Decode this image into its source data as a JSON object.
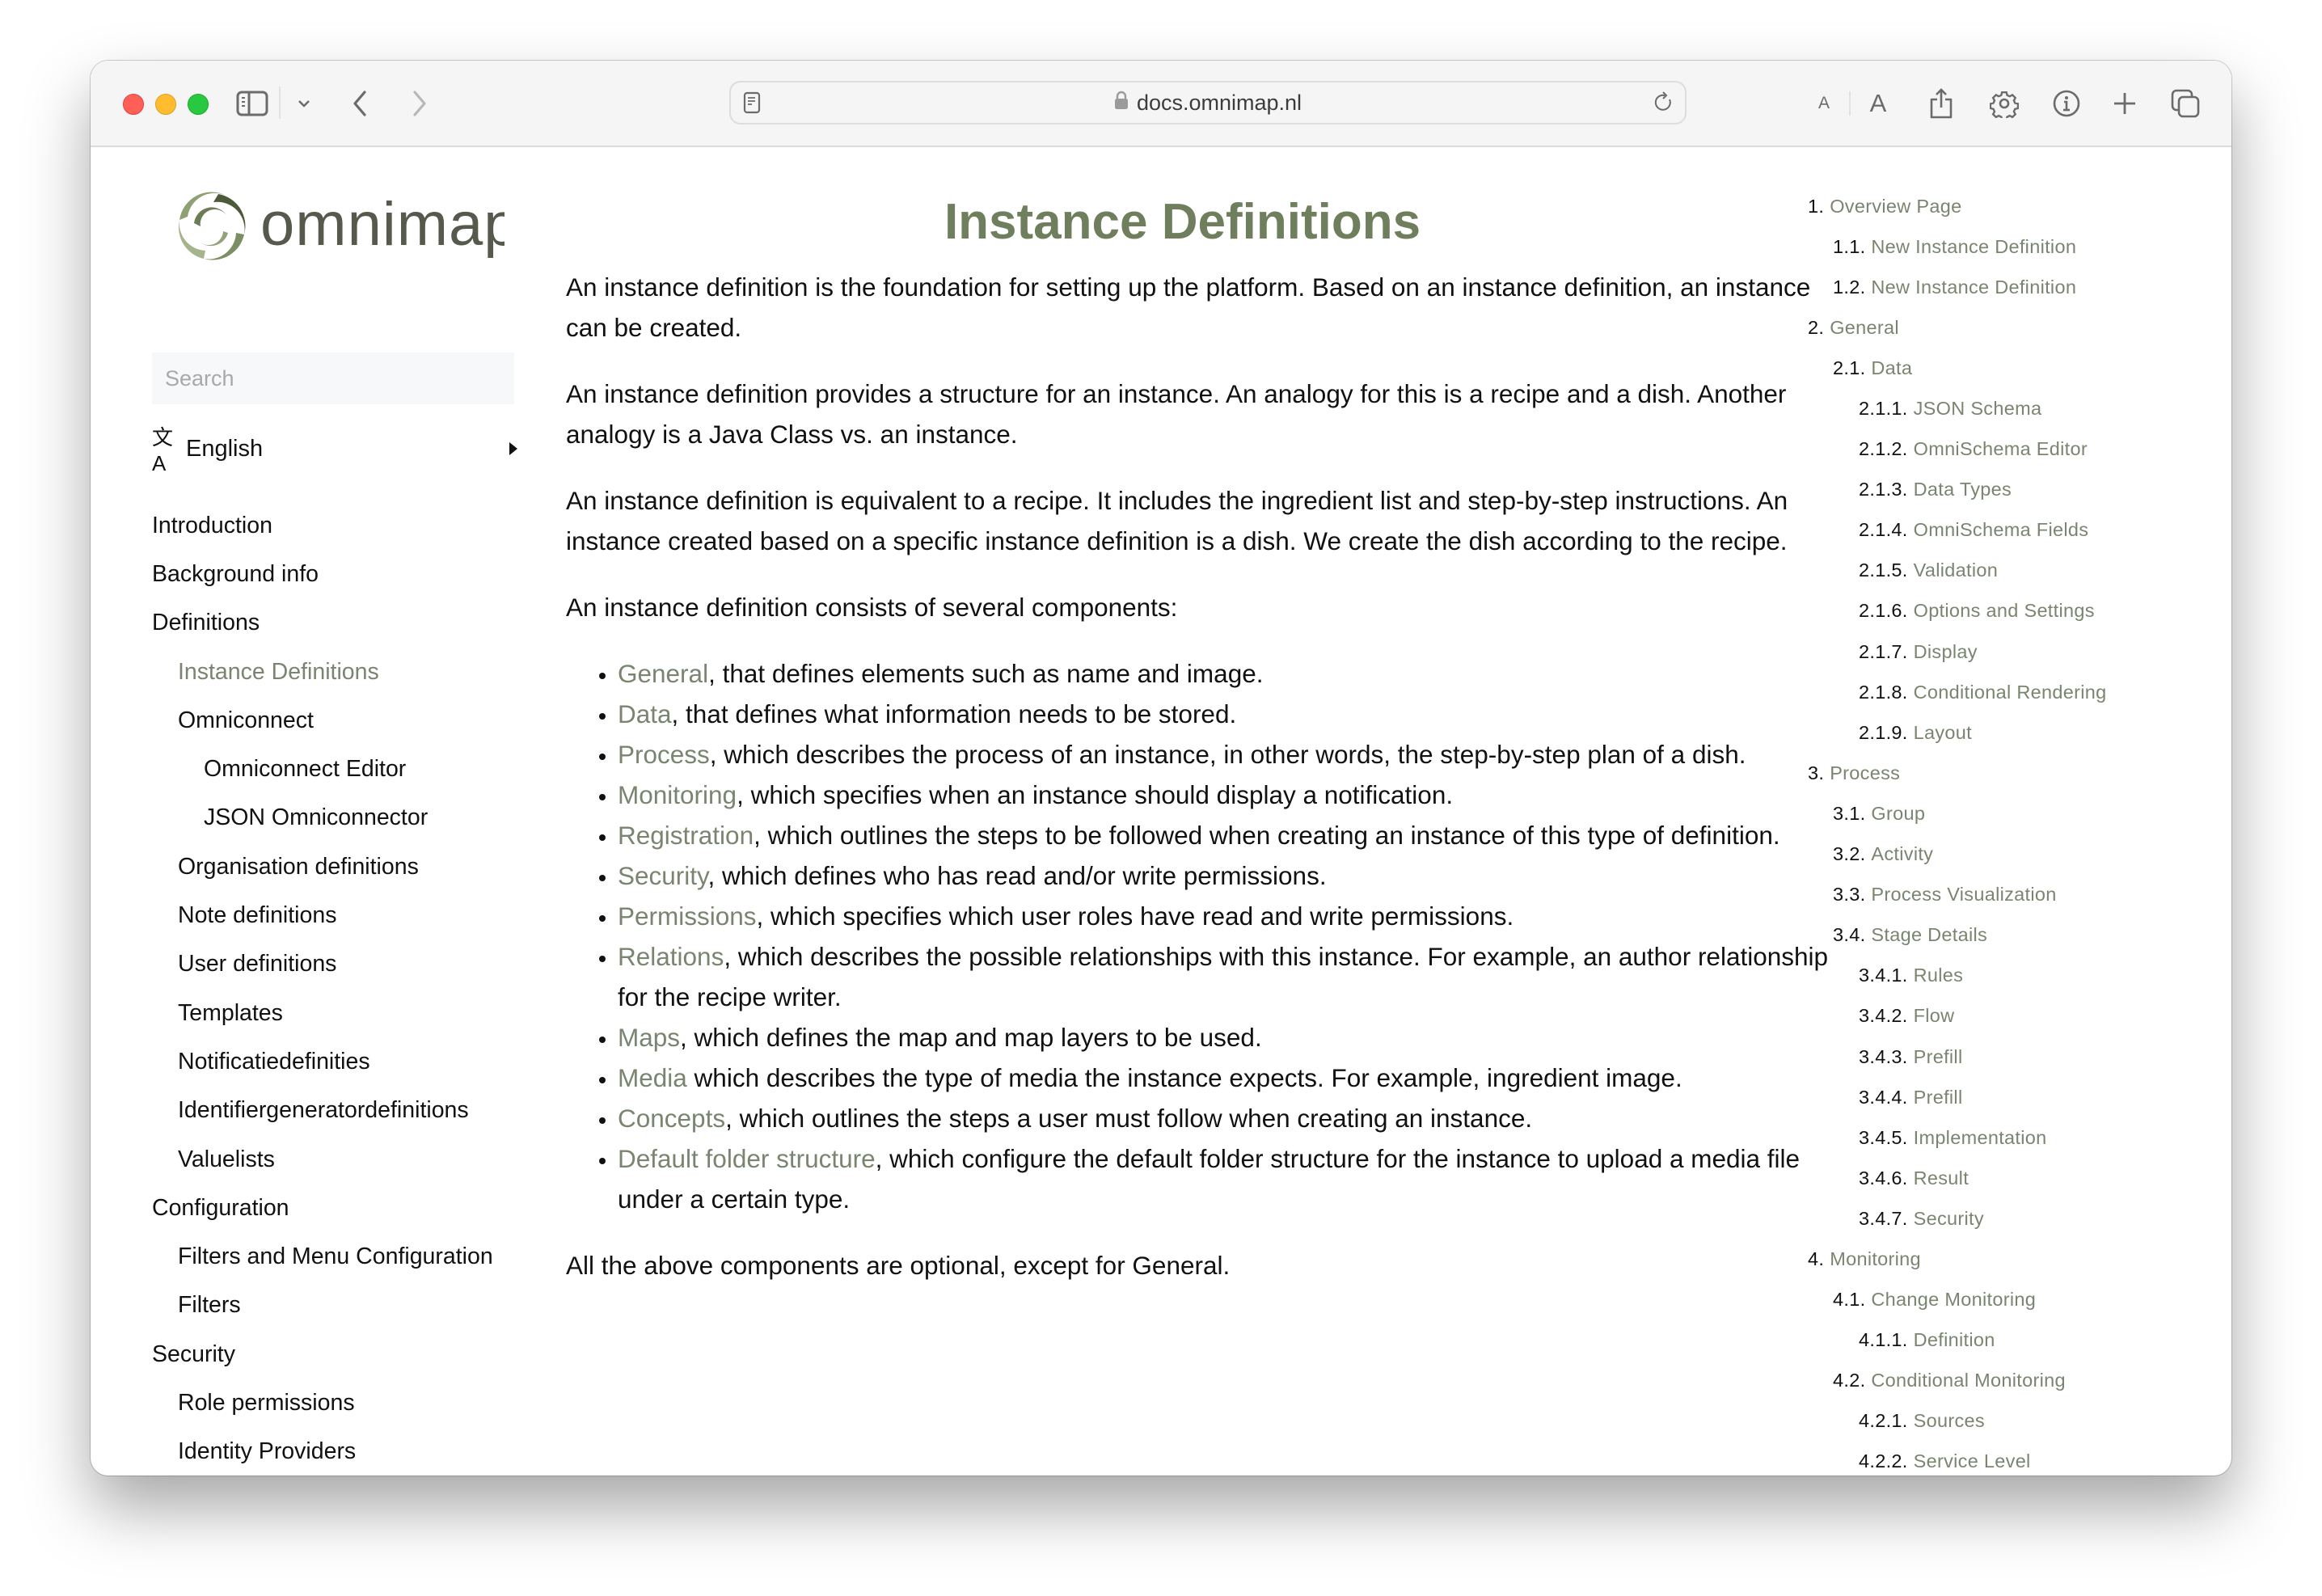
{
  "browser": {
    "url": "docs.omnimap.nl",
    "toolbar_icons": [
      "sidebar-icon",
      "chevron-down-icon",
      "back-icon",
      "forward-icon",
      "reader-icon",
      "lock-icon",
      "reload-icon",
      "text-smaller-icon",
      "text-larger-icon",
      "share-icon",
      "gear-icon",
      "info-icon",
      "plus-icon",
      "tabs-overview-icon"
    ],
    "text_small_label": "A",
    "text_large_label": "A"
  },
  "sidebar": {
    "logo_text": "omnimap",
    "search_placeholder": "Search",
    "language": {
      "icon": "translate-icon",
      "glyph": "文A",
      "label": "English"
    },
    "items": [
      {
        "label": "Introduction",
        "level": 0
      },
      {
        "label": "Background info",
        "level": 0
      },
      {
        "label": "Definitions",
        "level": 0
      },
      {
        "label": "Instance Definitions",
        "level": 1,
        "active": true
      },
      {
        "label": "Omniconnect",
        "level": 1
      },
      {
        "label": "Omniconnect Editor",
        "level": 2
      },
      {
        "label": "JSON Omniconnector",
        "level": 2
      },
      {
        "label": "Organisation definitions",
        "level": 1
      },
      {
        "label": "Note definitions",
        "level": 1
      },
      {
        "label": "User definitions",
        "level": 1
      },
      {
        "label": "Templates",
        "level": 1
      },
      {
        "label": "Notificatiedefinities",
        "level": 1
      },
      {
        "label": "Identifiergeneratordefinitions",
        "level": 1
      },
      {
        "label": "Valuelists",
        "level": 1
      },
      {
        "label": "Configuration",
        "level": 0
      },
      {
        "label": "Filters and Menu Configuration",
        "level": 1
      },
      {
        "label": "Filters",
        "level": 1
      },
      {
        "label": "Security",
        "level": 0
      },
      {
        "label": "Role permissions",
        "level": 1
      },
      {
        "label": "Identity Providers",
        "level": 1
      }
    ]
  },
  "main": {
    "title": "Instance Definitions",
    "paragraphs": [
      "An instance definition is the foundation for setting up the platform. Based on an instance definition, an instance can be created.",
      "An instance definition provides a structure for an instance. An analogy for this is a recipe and a dish. Another analogy is a Java Class vs. an instance.",
      "An instance definition is equivalent to a recipe. It includes the ingredient list and step-by-step instructions. An instance created based on a specific instance definition is a dish. We create the dish according to the recipe.",
      "An instance definition consists of several components:"
    ],
    "components": [
      {
        "link": "General",
        "text": ", that defines elements such as name and image."
      },
      {
        "link": "Data",
        "text": ", that defines what information needs to be stored."
      },
      {
        "link": "Process",
        "text": ", which describes the process of an instance, in other words, the step-by-step plan of a dish."
      },
      {
        "link": "Monitoring",
        "text": ", which specifies when an instance should display a notification."
      },
      {
        "link": "Registration",
        "text": ", which outlines the steps to be followed when creating an instance of this type of definition."
      },
      {
        "link": "Security",
        "text": ", which defines who has read and/or write permissions."
      },
      {
        "link": "Permissions",
        "text": ", which specifies which user roles have read and write permissions."
      },
      {
        "link": "Relations",
        "text": ", which describes the possible relationships with this instance. For example, an author relationship for the recipe writer."
      },
      {
        "link": "Maps",
        "text": ", which defines the map and map layers to be used."
      },
      {
        "link": "Media",
        "text": " which describes the type of media the instance expects. For example, ingredient image."
      },
      {
        "link": "Concepts",
        "text": ", which outlines the steps a user must follow when creating an instance."
      },
      {
        "link": "Default folder structure",
        "text": ", which configure the default folder structure for the instance to upload a media file under a certain type."
      }
    ],
    "closing": "All the above components are optional, except for General."
  },
  "toc": {
    "items": [
      {
        "num": "1.",
        "label": "Overview Page",
        "depth": 0
      },
      {
        "num": "1.1.",
        "label": "New Instance Definition",
        "depth": 1
      },
      {
        "num": "1.2.",
        "label": "New Instance Definition",
        "depth": 1
      },
      {
        "num": "2.",
        "label": "General",
        "depth": 0
      },
      {
        "num": "2.1.",
        "label": "Data",
        "depth": 1
      },
      {
        "num": "2.1.1.",
        "label": "JSON Schema",
        "depth": 2
      },
      {
        "num": "2.1.2.",
        "label": "OmniSchema Editor",
        "depth": 2
      },
      {
        "num": "2.1.3.",
        "label": "Data Types",
        "depth": 2
      },
      {
        "num": "2.1.4.",
        "label": "OmniSchema Fields",
        "depth": 2
      },
      {
        "num": "2.1.5.",
        "label": "Validation",
        "depth": 2
      },
      {
        "num": "2.1.6.",
        "label": "Options and Settings",
        "depth": 2
      },
      {
        "num": "2.1.7.",
        "label": "Display",
        "depth": 2
      },
      {
        "num": "2.1.8.",
        "label": "Conditional Rendering",
        "depth": 2
      },
      {
        "num": "2.1.9.",
        "label": "Layout",
        "depth": 2
      },
      {
        "num": "3.",
        "label": "Process",
        "depth": 0
      },
      {
        "num": "3.1.",
        "label": "Group",
        "depth": 1
      },
      {
        "num": "3.2.",
        "label": "Activity",
        "depth": 1
      },
      {
        "num": "3.3.",
        "label": "Process Visualization",
        "depth": 1
      },
      {
        "num": "3.4.",
        "label": "Stage Details",
        "depth": 1
      },
      {
        "num": "3.4.1.",
        "label": "Rules",
        "depth": 2
      },
      {
        "num": "3.4.2.",
        "label": "Flow",
        "depth": 2
      },
      {
        "num": "3.4.3.",
        "label": "Prefill",
        "depth": 2
      },
      {
        "num": "3.4.4.",
        "label": "Prefill",
        "depth": 2
      },
      {
        "num": "3.4.5.",
        "label": "Implementation",
        "depth": 2
      },
      {
        "num": "3.4.6.",
        "label": "Result",
        "depth": 2
      },
      {
        "num": "3.4.7.",
        "label": "Security",
        "depth": 2
      },
      {
        "num": "4.",
        "label": "Monitoring",
        "depth": 0
      },
      {
        "num": "4.1.",
        "label": "Change Monitoring",
        "depth": 1
      },
      {
        "num": "4.1.1.",
        "label": "Definition",
        "depth": 2
      },
      {
        "num": "4.2.",
        "label": "Conditional Monitoring",
        "depth": 1
      },
      {
        "num": "4.2.1.",
        "label": "Sources",
        "depth": 2
      },
      {
        "num": "4.2.2.",
        "label": "Service Level",
        "depth": 2
      }
    ]
  },
  "colors": {
    "accent": "#6f7f5e",
    "link": "#7a8570",
    "text": "#111111",
    "toolbar_bg": "#f5f5f5"
  }
}
